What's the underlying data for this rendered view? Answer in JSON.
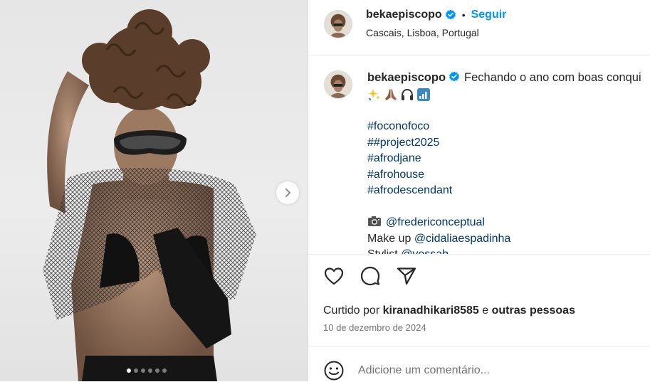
{
  "post": {
    "dots_count": 6,
    "active_dot": 0
  },
  "header": {
    "username": "bekaepiscopo",
    "separator": "•",
    "follow_label": "Seguir",
    "location": "Cascais, Lisboa, Portugal"
  },
  "caption": {
    "username": "bekaepiscopo",
    "text": "Fechando o ano com boas conqui",
    "emojis": [
      "sparkles-icon",
      "praying-hands-icon",
      "headphones-icon",
      "signal-bars-icon"
    ],
    "hashtags": [
      "#foconofoco",
      "##project2025",
      "#afrodjane",
      "#afrohouse",
      "#afrodescendant"
    ],
    "credits": [
      {
        "prefix": "",
        "mention": "@fredericonceptual",
        "icon": "camera-icon"
      },
      {
        "prefix": "Make up ",
        "mention": "@cidaliaespadinha"
      },
      {
        "prefix": "Stylist ",
        "mention": "@yossab"
      }
    ]
  },
  "actions": {
    "like": "heart-icon",
    "comment": "comment-icon",
    "share": "send-icon"
  },
  "likes": {
    "prefix": "Curtido por ",
    "user": "kiranadhikari8585",
    "middle": " e ",
    "others": "outras pessoas"
  },
  "date": "10 de dezembro de 2024",
  "comment": {
    "placeholder": "Adicione um comentário..."
  },
  "colors": {
    "link_blue": "#0095f6",
    "hashtag_blue": "#00376b",
    "verified_blue": "#0095f6",
    "muted_text": "#737373"
  }
}
